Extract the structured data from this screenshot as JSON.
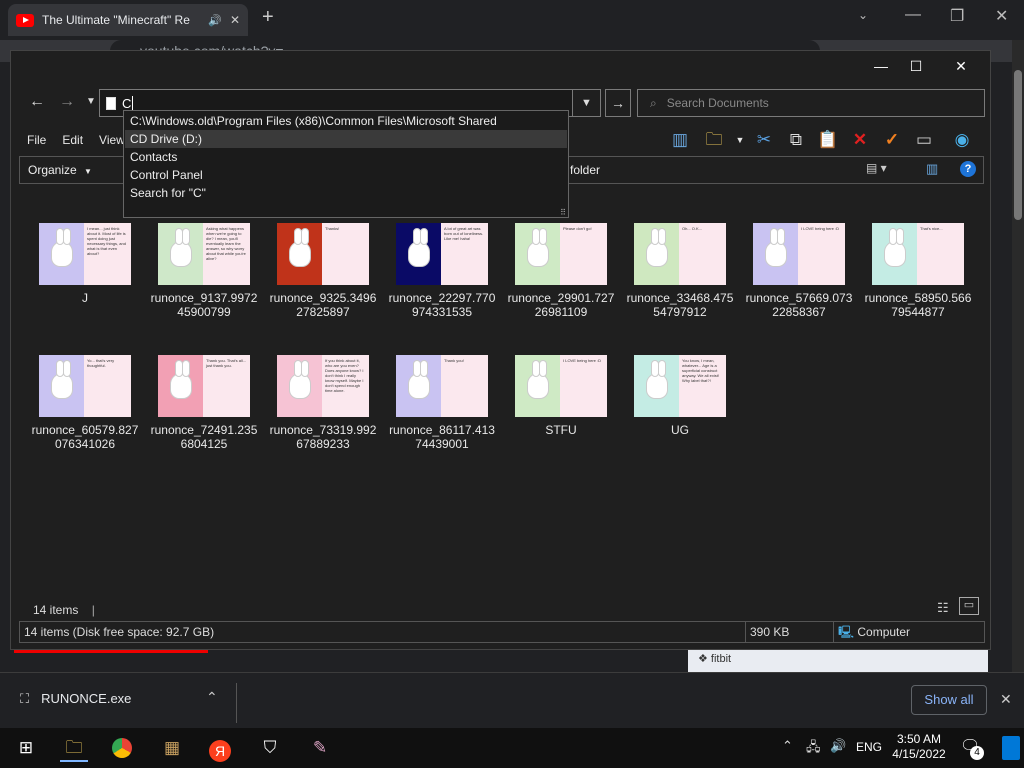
{
  "browser": {
    "tab_title": "The Ultimate \"Minecraft\" Re",
    "omnibox": "youtube.com/watch?v=..."
  },
  "explorer": {
    "address_value": "C",
    "search_placeholder": "Search Documents",
    "menu": [
      "File",
      "Edit",
      "View"
    ],
    "organize_label": "Organize",
    "new_folder_label": "folder",
    "autocomplete": [
      "C:\\Windows.old\\Program Files (x86)\\Common Files\\Microsoft Shared",
      "CD Drive (D:)",
      "Contacts",
      "Control Panel",
      "Search for \"C\""
    ],
    "autocomplete_selected": 1,
    "files": [
      {
        "name": "J",
        "left_color": "#c9c3f2",
        "caption": "I mean... just think about it. Most of life is spent doing just necessary things, and what is that even about?"
      },
      {
        "name": "runonce_9137.997245900799",
        "left_color": "#cfe8c9",
        "caption": "Asking what happens when we're going to die? I mean, you'll eventually learn the answer, so why worry about that while you're alive?"
      },
      {
        "name": "runonce_9325.349627825897",
        "left_color": "#c0331a",
        "caption": "Thanks!"
      },
      {
        "name": "runonce_22297.770974331535",
        "left_color": "#0a0a66",
        "caption": "A lot of great art was born out of loneliness. Like me! haha!"
      },
      {
        "name": "runonce_29901.72726981109",
        "left_color": "#cfeac5",
        "caption": "Please don't go!"
      },
      {
        "name": "runonce_33468.47554797912",
        "left_color": "#cfe8c0",
        "caption": "Oh... O.K..."
      },
      {
        "name": "runonce_57669.07322858367",
        "left_color": "#c9c3f2",
        "caption": "I LOVE being here :D"
      },
      {
        "name": "runonce_58950.56679544877",
        "left_color": "#c4ece4",
        "caption": "That's nice..."
      },
      {
        "name": "runonce_60579.827076341026",
        "left_color": "#c9c3f2",
        "caption": "Yo... that's very thoughtful."
      },
      {
        "name": "runonce_72491.2356804125",
        "left_color": "#f2a0b4",
        "caption": "Thank you. That's all... just thank you."
      },
      {
        "name": "runonce_73319.99267889233",
        "left_color": "#f6c3d4",
        "caption": "If you think about it, who are you even? Does anyone know? I don't think I really know myself. Maybe I don't spend enough time alone."
      },
      {
        "name": "runonce_86117.41374439001",
        "left_color": "#c9c3f2",
        "caption": "Thank you!"
      },
      {
        "name": "STFU",
        "left_color": "#cfeac5",
        "caption": "I LOVE being here :D"
      },
      {
        "name": "UG",
        "left_color": "#c4ece4",
        "caption": "You know, I mean, whatever... Age is a superficial construct anyway. We all exist! Why label that?!"
      }
    ],
    "item_count": "14 items",
    "status": {
      "summary": "14 items (Disk free space: 92.7 GB)",
      "size": "390 KB",
      "location": "Computer"
    }
  },
  "downloads": {
    "file": "RUNONCE.exe",
    "show_all": "Show all"
  },
  "taskbar": {
    "language": "ENG",
    "time": "3:50 AM",
    "date": "4/15/2022",
    "notifications": "4"
  }
}
